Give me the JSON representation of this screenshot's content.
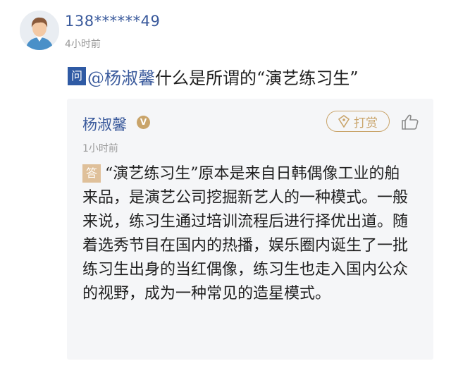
{
  "question_block": {
    "asker_name": "138******49",
    "asker_time": "4小时前",
    "badge": "问",
    "mention": "@杨淑馨",
    "text": "什么是所谓的“演艺练习生”"
  },
  "answer_block": {
    "answerer_name": "杨淑馨",
    "verified_icon": "v-badge-icon",
    "tip_label": "打赏",
    "tip_icon": "gem-icon",
    "like_icon": "thumbs-up-icon",
    "time": "1小时前",
    "badge": "答",
    "body": "“演艺练习生”原本是来自日韩偶像工业的舶来品，是演艺公司挖掘新艺人的一种模式。一般来说，练习生通过培训流程后进行择优出道。随着选秀节目在国内的热播，娱乐圈内诞生了一批练习生出身的当红偶像，练习生也走入国内公众的视野，成为一种常见的造星模式。"
  },
  "colors": {
    "link_blue": "#3a5a9c",
    "question_badge": "#2f5aa4",
    "answer_badge": "#dfc09a",
    "tip_gold": "#c9a46a",
    "card_bg": "#f5f6f8"
  }
}
